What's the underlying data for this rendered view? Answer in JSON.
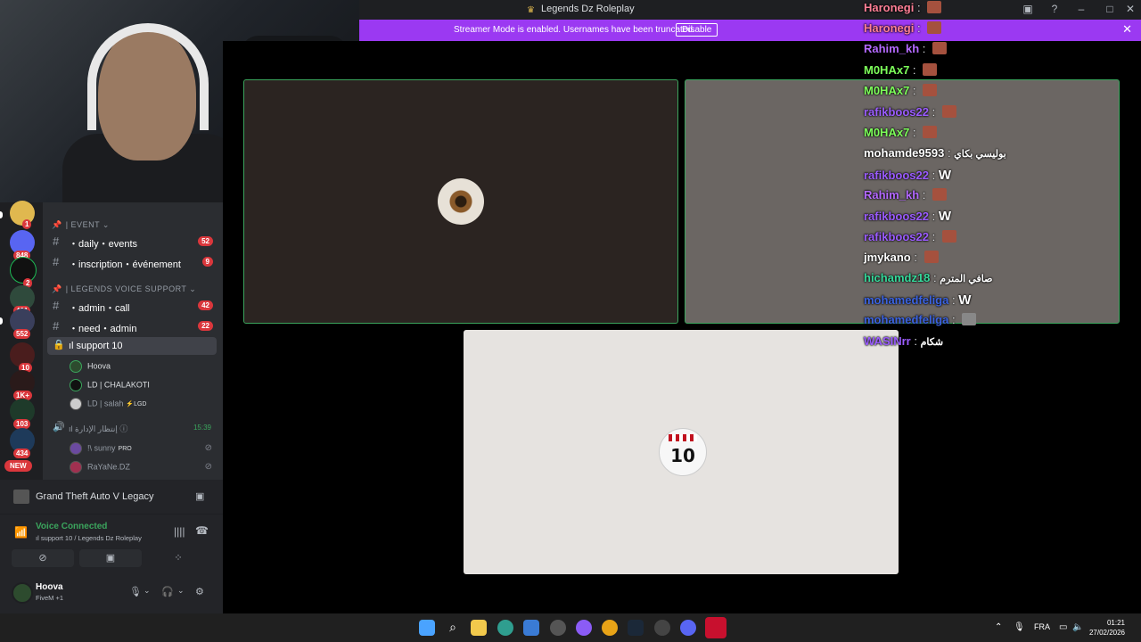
{
  "window": {
    "title": "Legends Dz Roleplay",
    "controls": [
      "screen-share-icon",
      "help-icon",
      "minimize-icon",
      "maximize-icon",
      "close-icon"
    ]
  },
  "banner": {
    "message": "Streamer Mode is enabled. Usernames have been truncated.",
    "action": "Disable",
    "color": "#9b39f2"
  },
  "servers": [
    {
      "badge": "1"
    },
    {
      "badge": "848"
    },
    {
      "badge": "2"
    },
    {
      "badge": "401"
    },
    {
      "badge": "552"
    },
    {
      "badge": "10"
    },
    {
      "badge": "1K+"
    },
    {
      "badge": "103"
    },
    {
      "badge": "434"
    },
    {
      "badge": "NEW"
    }
  ],
  "channels": {
    "cat_event": "| EVENT ⌄",
    "daily_events": {
      "label": "・daily・events",
      "count": "52"
    },
    "inscription": {
      "label": "・inscription・événement",
      "count": "9"
    },
    "cat_support": "| LEGENDS VOICE SUPPORT ⌄",
    "admin_call": {
      "label": "・admin・call",
      "count": "42"
    },
    "need_admin": {
      "label": "・need・admin",
      "count": "22"
    },
    "support10": {
      "label": "ıl support 10"
    },
    "support_users": [
      {
        "name": "Hoova"
      },
      {
        "name": "LD | CHALAKOTI"
      },
      {
        "name": "LD | salah",
        "tag": "⚡LGD"
      }
    ],
    "waiting": {
      "label": "ıl إنتظار الإدارة ⓘ",
      "time": "15:39"
    },
    "waiting_users": [
      {
        "name": "!\\ sunny",
        "tag": "PRO"
      },
      {
        "name": "RaYaNe.DZ"
      }
    ]
  },
  "activity": {
    "game": "Grand Theft Auto V Legacy"
  },
  "voice": {
    "status": "Voice Connected",
    "sub": "ıl support 10 / Legends Dz Roleplay"
  },
  "user": {
    "name": "Hoova",
    "status": "FiveM +1"
  },
  "chat": [
    {
      "user": "Haronegi",
      "color": "#ff7f96",
      "msg": "",
      "emote": "face"
    },
    {
      "user": "Haronegi",
      "color": "#ff7f96",
      "msg": "",
      "emote": "face"
    },
    {
      "user": "Rahim_kh",
      "color": "#b469ff",
      "msg": "",
      "emote": "face"
    },
    {
      "user": "M0HAx7",
      "color": "#7dff5a",
      "msg": "",
      "emote": "face"
    },
    {
      "user": "M0HAx7",
      "color": "#7dff5a",
      "msg": "",
      "emote": "face"
    },
    {
      "user": "rafikboos22",
      "color": "#9b5cff",
      "msg": "",
      "emote": "face"
    },
    {
      "user": "M0HAx7",
      "color": "#7dff5a",
      "msg": "",
      "emote": "face"
    },
    {
      "user": "mohamde9593",
      "color": "#ffffff",
      "msg": "بوليسي بكاي",
      "emote": ""
    },
    {
      "user": "rafikboos22",
      "color": "#9b5cff",
      "msg": "W",
      "emote": ""
    },
    {
      "user": "Rahim_kh",
      "color": "#b469ff",
      "msg": "",
      "emote": "face"
    },
    {
      "user": "rafikboos22",
      "color": "#9b5cff",
      "msg": "W",
      "emote": ""
    },
    {
      "user": "rafikboos22",
      "color": "#9b5cff",
      "msg": "",
      "emote": "face"
    },
    {
      "user": "jmykano",
      "color": "#ffffff",
      "msg": "",
      "emote": "face"
    },
    {
      "user": "hichamdz18",
      "color": "#35d99b",
      "msg": "صافي المترم",
      "emote": ""
    },
    {
      "user": "mohamedfeliga",
      "color": "#3b63e0",
      "msg": "W",
      "emote": ""
    },
    {
      "user": "mohamedfeliga",
      "color": "#3b63e0",
      "msg": "",
      "emote": "face"
    },
    {
      "user": "WASINrr",
      "color": "#9b5cff",
      "msg": "شكام",
      "emote": ""
    }
  ],
  "stage": {
    "tile_ten_label": "10"
  },
  "taskbar": {
    "lang": "FRA",
    "time": "01:21",
    "date": "27/02/2026"
  }
}
